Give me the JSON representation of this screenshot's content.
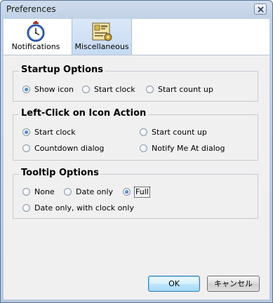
{
  "window": {
    "title": "Preferences"
  },
  "toolbar": {
    "tabs": [
      {
        "label": "Notifications",
        "icon": "clock-icon",
        "selected": false
      },
      {
        "label": "Miscellaneous",
        "icon": "misc-settings-icon",
        "selected": true
      }
    ]
  },
  "groups": {
    "startup": {
      "title": "Startup Options",
      "options": [
        {
          "label": "Show icon",
          "checked": true
        },
        {
          "label": "Start clock",
          "checked": false
        },
        {
          "label": "Start count up",
          "checked": false
        }
      ]
    },
    "leftclick": {
      "title": "Left-Click on Icon Action",
      "options": [
        {
          "label": "Start clock",
          "checked": true
        },
        {
          "label": "Start count up",
          "checked": false
        },
        {
          "label": "Countdown dialog",
          "checked": false
        },
        {
          "label": "Notify Me At dialog",
          "checked": false
        }
      ]
    },
    "tooltip": {
      "title": "Tooltip Options",
      "options": [
        {
          "label": "None",
          "checked": false
        },
        {
          "label": "Date only",
          "checked": false
        },
        {
          "label": "Full",
          "checked": true
        },
        {
          "label": "Date only, with clock only",
          "checked": false
        }
      ]
    }
  },
  "buttons": {
    "ok": "OK",
    "cancel": "キャンセル"
  },
  "colors": {
    "selected_tab": "#c6daf3",
    "dialog_background": "#f0f0f0",
    "radio_selected": "#1d5fb2"
  }
}
